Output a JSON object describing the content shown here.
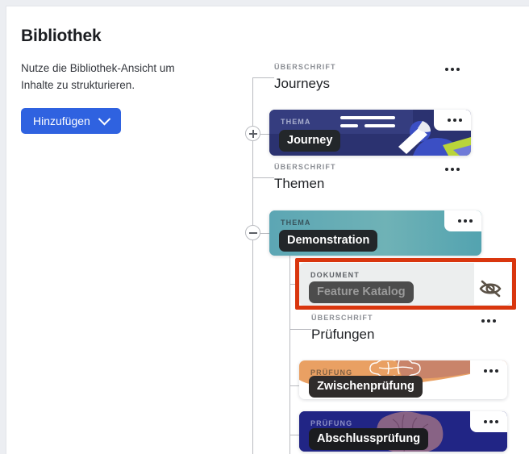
{
  "panel": {
    "title": "Bibliothek",
    "description": "Nutze die Bibliothek-Ansicht um Inhalte zu strukturieren.",
    "add_button_label": "Hinzufügen",
    "chevron_icon": "chevron-down-icon"
  },
  "colors": {
    "accent_blue": "#2f62e0",
    "journey_navy": "#2b3270",
    "thema_teal": "#63aab4",
    "pruefung_navy": "#212585",
    "highlight_red": "#d9360e",
    "pill_dark": "#23272a",
    "document_card_bg": "#eceeee"
  },
  "tree": {
    "nodes": [
      {
        "type": "heading",
        "kicker": "ÜBERSCHRIFT",
        "title": "Journeys",
        "menu_icon": "more-options-icon"
      },
      {
        "type": "card",
        "kicker": "THEMA",
        "title": "Journey",
        "menu_icon": "more-options-icon",
        "toggle": "plus",
        "toggle_icon": "expand-plus-icon"
      },
      {
        "type": "heading",
        "kicker": "ÜBERSCHRIFT",
        "title": "Themen",
        "menu_icon": "more-options-icon"
      },
      {
        "type": "card",
        "kicker": "THEMA",
        "title": "Demonstration",
        "menu_icon": "more-options-icon",
        "toggle": "minus",
        "toggle_icon": "collapse-minus-icon"
      },
      {
        "type": "document",
        "kicker": "DOKUMENT",
        "title": "Feature Katalog",
        "menu_icon": "more-options-icon",
        "visibility_icon": "eye-off-icon",
        "highlighted": true
      },
      {
        "type": "heading",
        "kicker": "ÜBERSCHRIFT",
        "title": "Prüfungen",
        "menu_icon": "more-options-icon"
      },
      {
        "type": "card",
        "kicker": "PRÜFUNG",
        "title": "Zwischenprüfung",
        "menu_icon": "more-options-icon"
      },
      {
        "type": "card",
        "kicker": "PRÜFUNG",
        "title": "Abschlussprüfung",
        "menu_icon": "more-options-icon"
      }
    ]
  }
}
